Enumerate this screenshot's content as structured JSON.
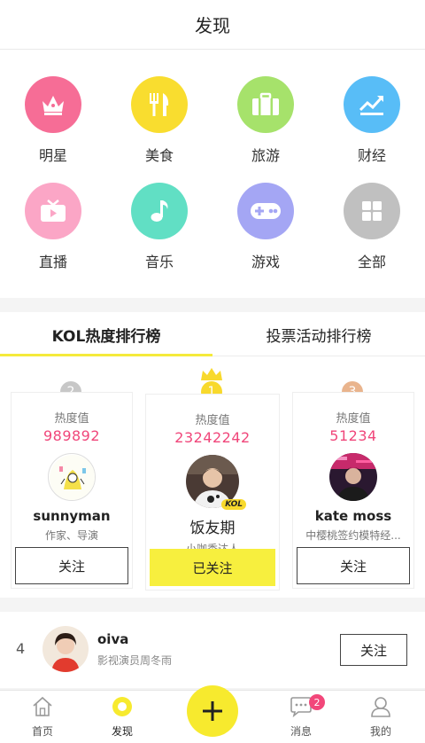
{
  "header": {
    "title": "发现"
  },
  "categories": [
    {
      "label": "明星",
      "icon": "crown-icon",
      "color": "#f66d96"
    },
    {
      "label": "美食",
      "icon": "fork-knife-icon",
      "color": "#f9dd2f"
    },
    {
      "label": "旅游",
      "icon": "suitcase-icon",
      "color": "#a6e26b"
    },
    {
      "label": "财经",
      "icon": "trend-chart-icon",
      "color": "#58bdf7"
    },
    {
      "label": "直播",
      "icon": "tv-icon",
      "color": "#fba6c6"
    },
    {
      "label": "音乐",
      "icon": "music-note-icon",
      "color": "#61dfc4"
    },
    {
      "label": "游戏",
      "icon": "gamepad-icon",
      "color": "#a4a6f4"
    },
    {
      "label": "全部",
      "icon": "grid-icon",
      "color": "#c0c0c0"
    }
  ],
  "tabs": [
    {
      "label": "KOL热度排行榜",
      "active": true
    },
    {
      "label": "投票活动排行榜",
      "active": false
    }
  ],
  "top3": [
    {
      "rank": "2",
      "heat_label": "热度值",
      "heat": "989892",
      "name": "sunnyman",
      "desc": "作家、导演",
      "button": "关注",
      "rank_color": "#c7c7c7"
    },
    {
      "rank": "1",
      "heat_label": "热度值",
      "heat": "23242242",
      "name": "饭友期",
      "desc": "小咖秀达人",
      "button": "已关注",
      "rank_color": "#f8d92c",
      "badge": "KOL"
    },
    {
      "rank": "3",
      "heat_label": "热度值",
      "heat": "51234",
      "name": "kate moss",
      "desc": "中樱桃签约模特经...",
      "button": "关注",
      "rank_color": "#e9b48d"
    }
  ],
  "list": [
    {
      "rank": "4",
      "name": "oiva",
      "desc": "影视演员周冬雨",
      "button": "关注"
    }
  ],
  "tabbar": {
    "items": [
      {
        "label": "首页",
        "icon": "home-icon"
      },
      {
        "label": "发现",
        "icon": "discover-icon",
        "active": true
      },
      {
        "label": "",
        "icon": "plus-icon"
      },
      {
        "label": "消息",
        "icon": "chat-icon",
        "badge": "2"
      },
      {
        "label": "我的",
        "icon": "user-icon"
      }
    ]
  }
}
